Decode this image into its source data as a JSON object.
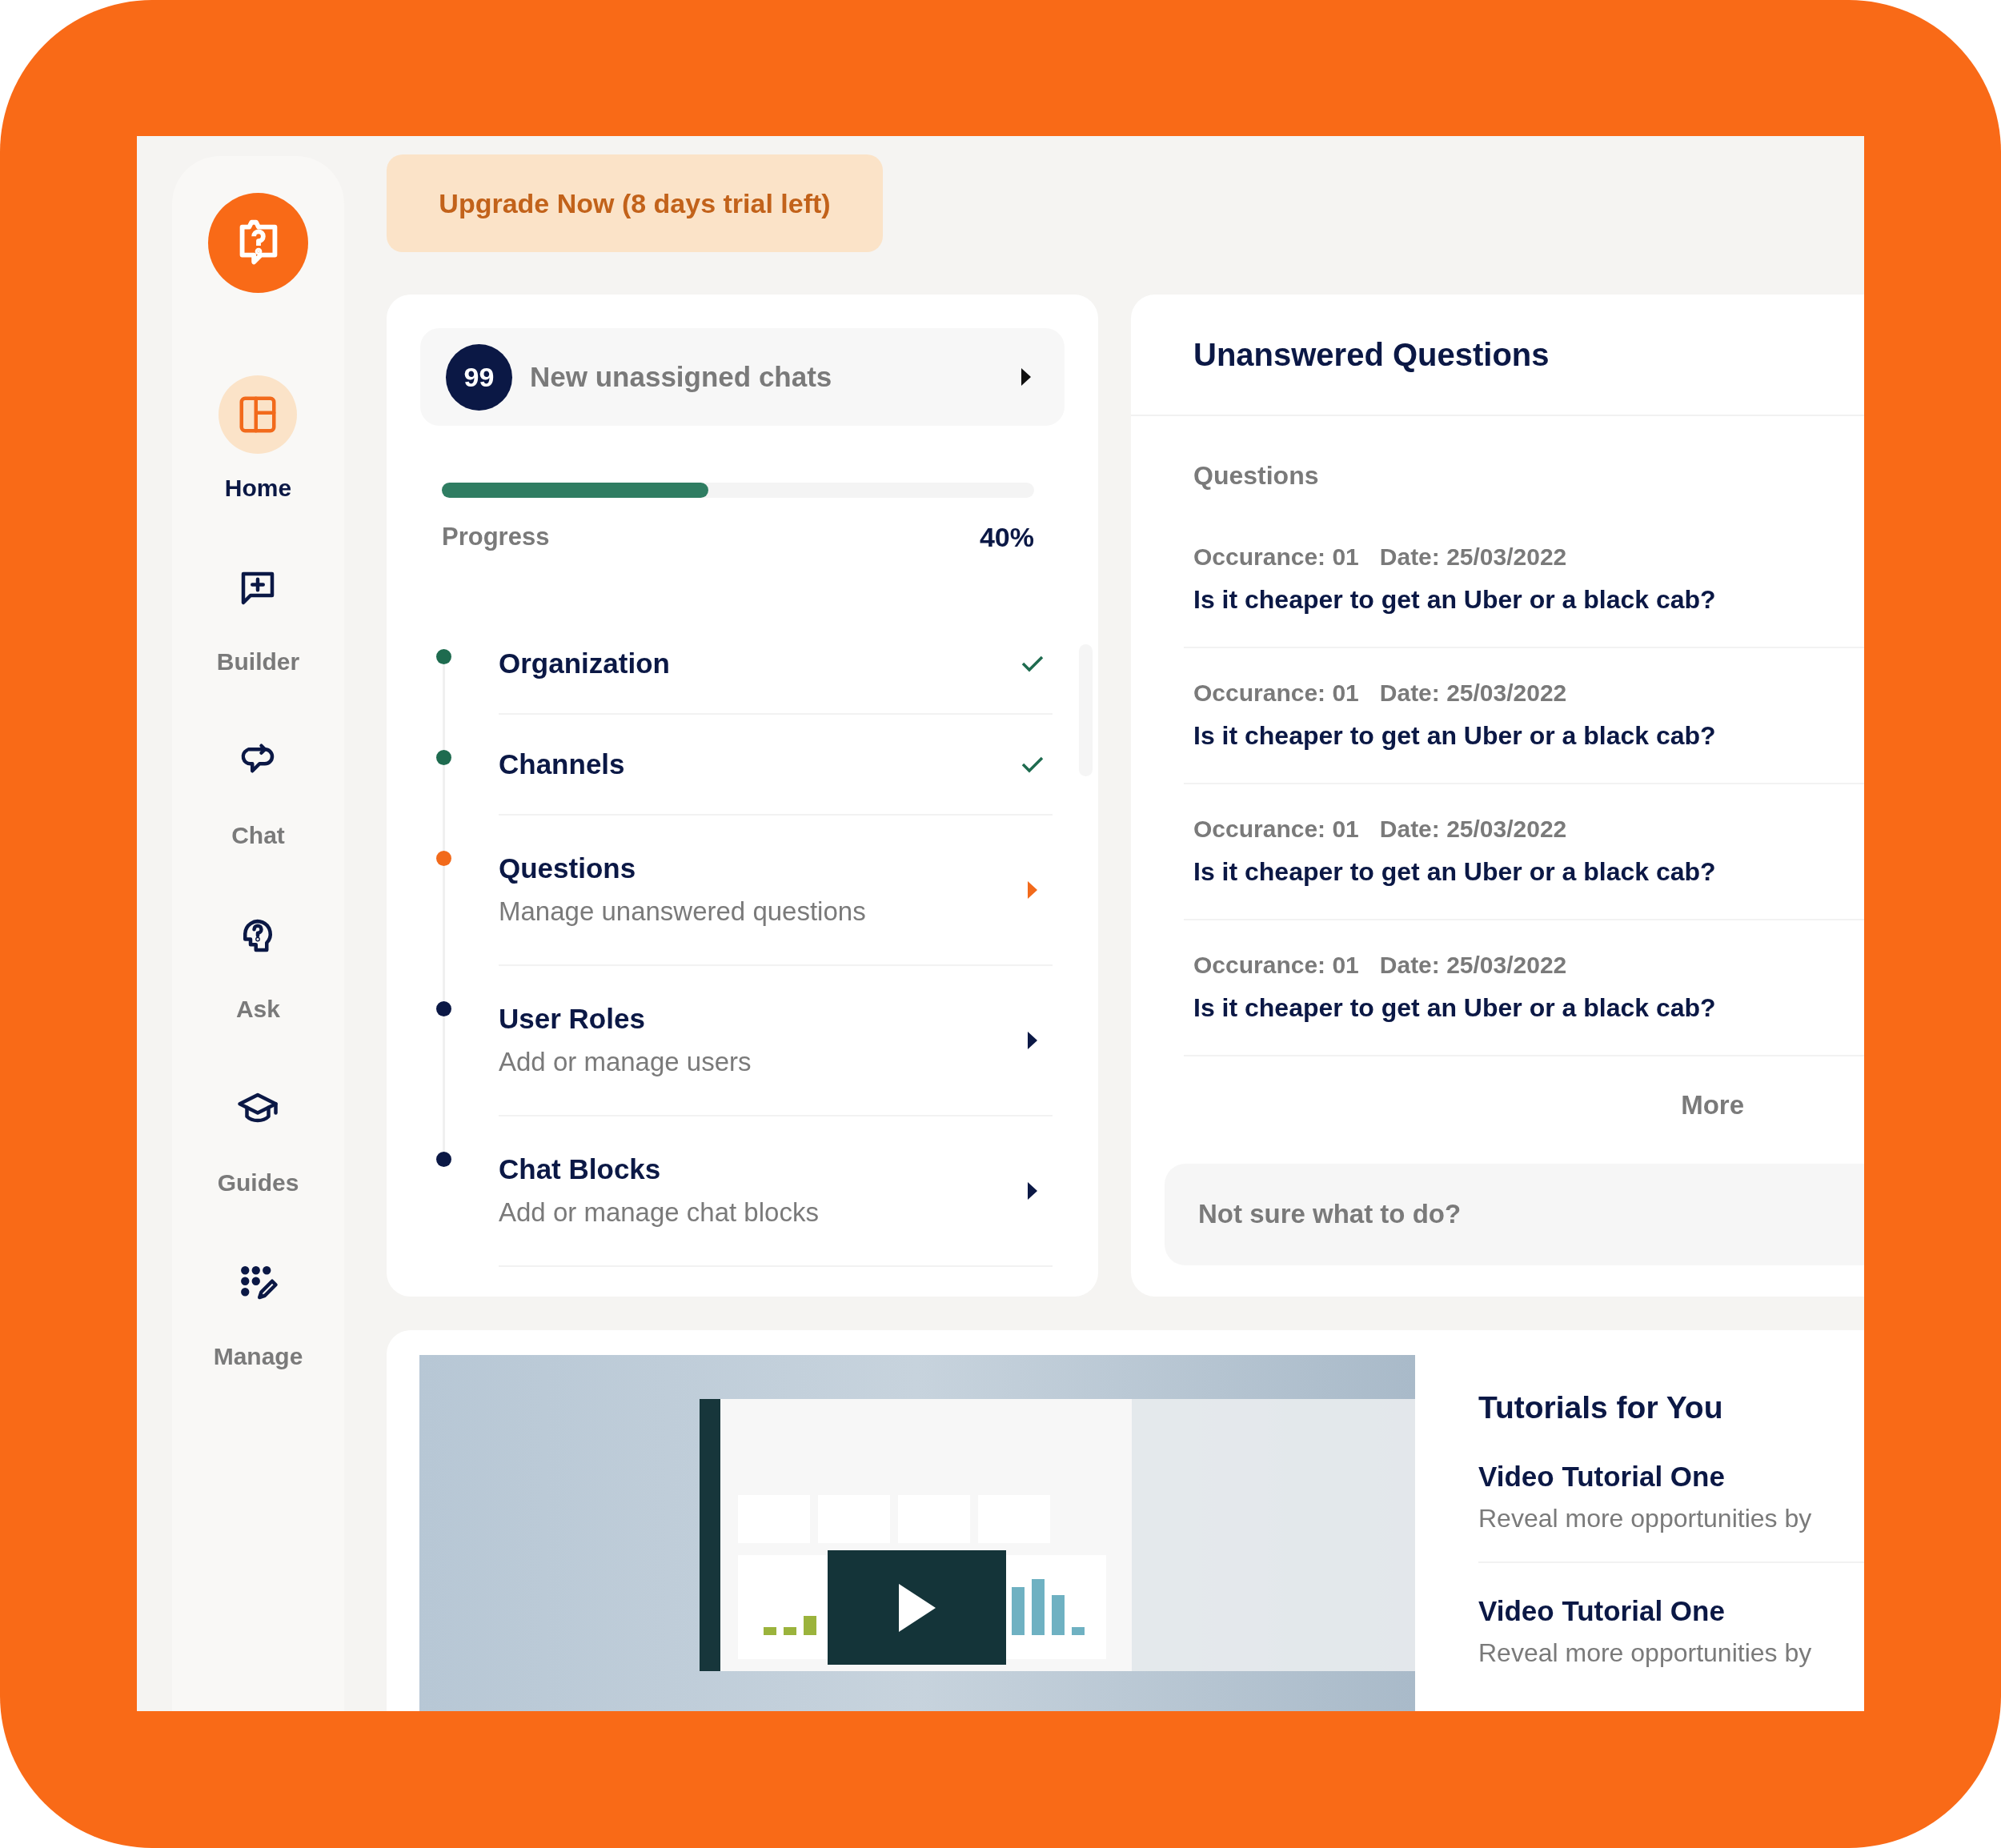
{
  "sidebar": {
    "items": [
      {
        "label": "Home",
        "selected": true
      },
      {
        "label": "Builder",
        "selected": false
      },
      {
        "label": "Chat",
        "selected": false
      },
      {
        "label": "Ask",
        "selected": false
      },
      {
        "label": "Guides",
        "selected": false
      },
      {
        "label": "Manage",
        "selected": false
      }
    ]
  },
  "upgrade_button": "Upgrade Now (8 days trial left)",
  "unassigned": {
    "count": "99",
    "label": "New unassigned chats"
  },
  "progress": {
    "label": "Progress",
    "value": "40%",
    "level": 0.45
  },
  "steps": [
    {
      "title": "Organization",
      "completed": true,
      "current": false
    },
    {
      "title": "Channels",
      "completed": true,
      "current": false
    },
    {
      "title": "Questions",
      "subtitle": "Manage unanswered questions",
      "completed": false,
      "current": true
    },
    {
      "title": "User Roles",
      "subtitle": "Add or manage users",
      "completed": false,
      "current": false
    },
    {
      "title": "Chat Blocks",
      "subtitle": "Add or manage chat blocks",
      "completed": false,
      "current": false
    }
  ],
  "unanswered": {
    "title": "Unanswered Questions",
    "column_label": "Questions",
    "items": [
      {
        "occurrence": "Occurance: 01",
        "date": "Date: 25/03/2022",
        "question": "Is it cheaper to get an Uber or a black cab?"
      },
      {
        "occurrence": "Occurance: 01",
        "date": "Date: 25/03/2022",
        "question": "Is it cheaper to get an Uber or a black cab?"
      },
      {
        "occurrence": "Occurance: 01",
        "date": "Date: 25/03/2022",
        "question": "Is it cheaper to get an Uber or a black cab?"
      },
      {
        "occurrence": "Occurance: 01",
        "date": "Date: 25/03/2022",
        "question": "Is it cheaper to get an Uber or a black cab?"
      }
    ],
    "more": "More",
    "help": "Not sure what to do?"
  },
  "tutorials": {
    "title": "Tutorials for You",
    "items": [
      {
        "title": "Video Tutorial One",
        "description": "Reveal more opportunities by"
      },
      {
        "title": "Video Tutorial One",
        "description": "Reveal more opportunities by"
      }
    ]
  }
}
